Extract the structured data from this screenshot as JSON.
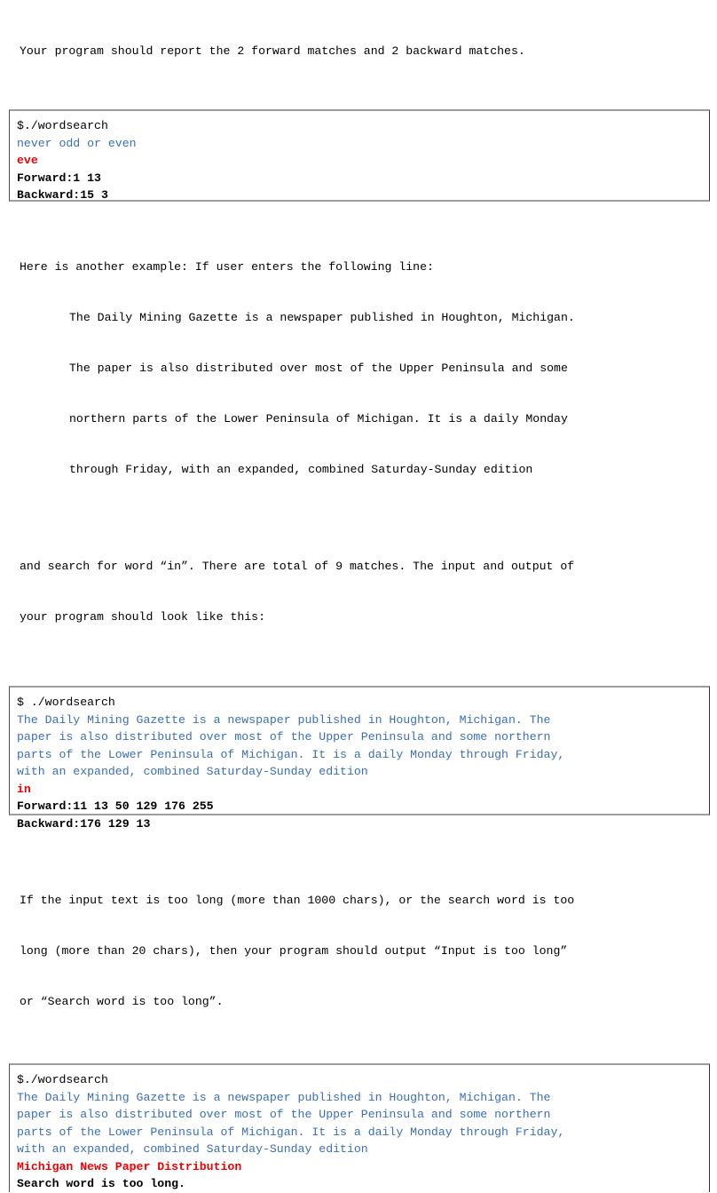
{
  "colors": {
    "input_blue": "#3a6fb5",
    "keyword_red": "#f00000",
    "text_black": "#000000",
    "box_border_gray": "#9d9d9d",
    "box_border_dark": "#2f2f38",
    "background": "#ffffff"
  },
  "intro": {
    "line1": "Your program should report the 2 forward matches and 2 backward matches."
  },
  "example1": {
    "command": "$./wordsearch",
    "input_text": "never odd or even",
    "search_word": "eve",
    "forward_label": "Forward:",
    "forward_values": "1 13",
    "backward_label": "Backward:",
    "backward_values": "15 3",
    "forward_line": "Forward:1 13",
    "backward_line": "Backward:15 3"
  },
  "body1": {
    "line1": "Here is another example: If user enters the following line:",
    "quote_line1": "The Daily Mining Gazette is a newspaper published in Houghton, Michigan.",
    "quote_line2": "The paper is also distributed over most of the Upper Peninsula and some",
    "quote_line3": "northern parts of the Lower Peninsula of Michigan. It is a daily Monday",
    "quote_line4": "through Friday, with an expanded, combined Saturday-Sunday edition",
    "line2": "and search for word “in”. There are total of 9 matches. The input and output of",
    "line3": "your program should look like this:"
  },
  "example2": {
    "command": "$ ./wordsearch",
    "input_line1": "The Daily Mining Gazette is a newspaper published in Houghton, Michigan. The",
    "input_line2": "paper is also distributed over most of the Upper Peninsula and some northern",
    "input_line3": "parts of the Lower Peninsula of Michigan. It is a daily Monday through Friday,",
    "input_line4": "with an expanded, combined Saturday-Sunday edition",
    "search_word": "in",
    "forward_line": "Forward:11 13 50 129 176 255",
    "backward_line": "Backward:176 129 13"
  },
  "body2": {
    "line1": "If the input text is too long (more than 1000 chars), or the search word is too",
    "line2": "long (more than 20 chars), then your program should output “Input is too long”",
    "line3": "or “Search word is too long”."
  },
  "example3": {
    "command": "$./wordsearch",
    "input_line1": "The Daily Mining Gazette is a newspaper published in Houghton, Michigan. The",
    "input_line2": "paper is also distributed over most of the Upper Peninsula and some northern",
    "input_line3": "parts of the Lower Peninsula of Michigan. It is a daily Monday through Friday,",
    "input_line4": "with an expanded, combined Saturday-Sunday edition",
    "search_word": "Michigan News Paper Distribution",
    "error_message": "Search word is too long."
  }
}
